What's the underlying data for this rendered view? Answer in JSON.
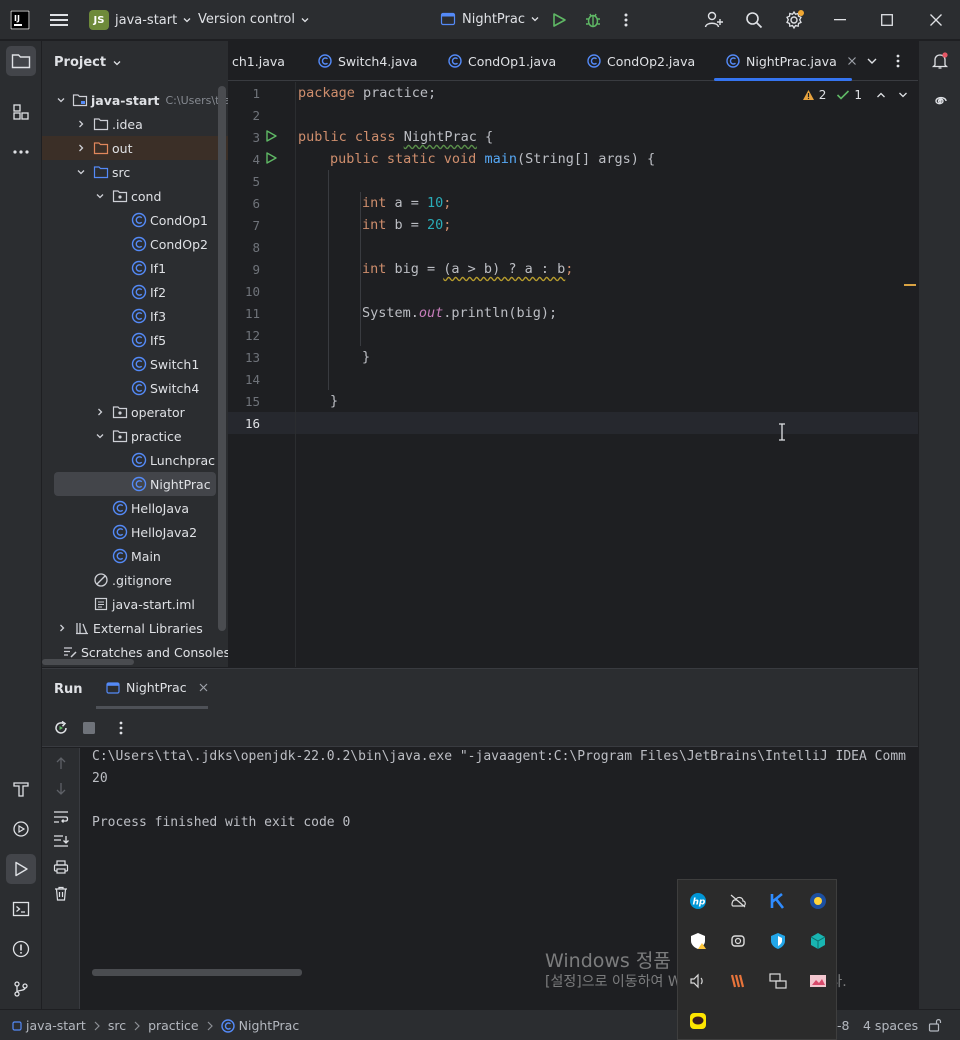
{
  "titlebar": {
    "project_badge": "JS",
    "project_name": "java-start",
    "vcs_label": "Version control",
    "run_config": "NightPrac"
  },
  "project_panel": {
    "title": "Project",
    "root_hint": "C:\\Users\\tta",
    "tree": [
      {
        "label": "java-start",
        "type": "module",
        "level": 0,
        "chevron": "down"
      },
      {
        "label": ".idea",
        "type": "folder",
        "level": 1,
        "chevron": "right"
      },
      {
        "label": "out",
        "type": "folder-excluded",
        "level": 1,
        "chevron": "right"
      },
      {
        "label": "src",
        "type": "folder-src",
        "level": 1,
        "chevron": "down"
      },
      {
        "label": "cond",
        "type": "package",
        "level": 2,
        "chevron": "down"
      },
      {
        "label": "CondOp1",
        "type": "class",
        "level": 3
      },
      {
        "label": "CondOp2",
        "type": "class",
        "level": 3
      },
      {
        "label": "If1",
        "type": "class",
        "level": 3
      },
      {
        "label": "If2",
        "type": "class",
        "level": 3
      },
      {
        "label": "If3",
        "type": "class",
        "level": 3
      },
      {
        "label": "If5",
        "type": "class",
        "level": 3
      },
      {
        "label": "Switch1",
        "type": "class",
        "level": 3
      },
      {
        "label": "Switch4",
        "type": "class",
        "level": 3
      },
      {
        "label": "operator",
        "type": "package",
        "level": 2,
        "chevron": "right"
      },
      {
        "label": "practice",
        "type": "package",
        "level": 2,
        "chevron": "down"
      },
      {
        "label": "Lunchprac",
        "type": "class",
        "level": 3
      },
      {
        "label": "NightPrac",
        "type": "class",
        "level": 3,
        "selected": true
      },
      {
        "label": "HelloJava",
        "type": "class",
        "level": 2
      },
      {
        "label": "HelloJava2",
        "type": "class",
        "level": 2
      },
      {
        "label": "Main",
        "type": "class",
        "level": 2
      },
      {
        "label": ".gitignore",
        "type": "ignore",
        "level": 1
      },
      {
        "label": "java-start.iml",
        "type": "file",
        "level": 1
      },
      {
        "label": "External Libraries",
        "type": "library",
        "level": 0,
        "chevron": "right"
      },
      {
        "label": "Scratches and Consoles",
        "type": "scratch",
        "level": 0
      }
    ]
  },
  "editor": {
    "tabs": [
      {
        "label": "ch1.java"
      },
      {
        "label": "Switch4.java"
      },
      {
        "label": "CondOp1.java"
      },
      {
        "label": "CondOp2.java"
      },
      {
        "label": "NightPrac.java",
        "active": true
      }
    ],
    "inspections": {
      "warnings": "2",
      "ok": "1"
    },
    "line_numbers": [
      "1",
      "2",
      "3",
      "4",
      "5",
      "6",
      "7",
      "8",
      "9",
      "10",
      "11",
      "12",
      "13",
      "14",
      "15",
      "16"
    ],
    "code": {
      "l1_kw": "package",
      "l1_rest": " practice;",
      "l3_kw": "public class",
      "l3_name": "NightPrac",
      "l3_rest": " {",
      "l4_kw": "public static void",
      "l4_fn": "main",
      "l4_rest": "(String[] args) {",
      "l6_kw": "int",
      "l6_mid": " a = ",
      "l6_num": "10",
      "l6_end": ";",
      "l7_kw": "int",
      "l7_mid": " b = ",
      "l7_num": "20",
      "l7_end": ";",
      "l9_kw": "int",
      "l9_mid": " big = ",
      "l9_expr": "(a > b) ? a : b",
      "l9_end": ";",
      "l11_a": "System.",
      "l11_field": "out",
      "l11_b": ".println(big);",
      "l13": "}",
      "l15": "}"
    }
  },
  "run_panel": {
    "title": "Run",
    "tab": "NightPrac",
    "console": [
      "C:\\Users\\tta\\.jdks\\openjdk-22.0.2\\bin\\java.exe \"-javaagent:C:\\Program Files\\JetBrains\\IntelliJ IDEA Comm",
      "20",
      "",
      "Process finished with exit code 0"
    ]
  },
  "statusbar": {
    "crumbs": [
      "java-start",
      "src",
      "practice",
      "NightPrac"
    ],
    "encoding_tail": "-8",
    "indent": "4 spaces"
  },
  "watermark": {
    "title": "Windows 정품 인증",
    "subtitle": "[설정]으로 이동하여 Windows를 정품 인증합니다."
  },
  "colors": {
    "accent": "#3574f0",
    "keyword": "#cf8e6d",
    "number": "#2aacb8",
    "function": "#56a8f5",
    "run_green": "#5fb865"
  }
}
